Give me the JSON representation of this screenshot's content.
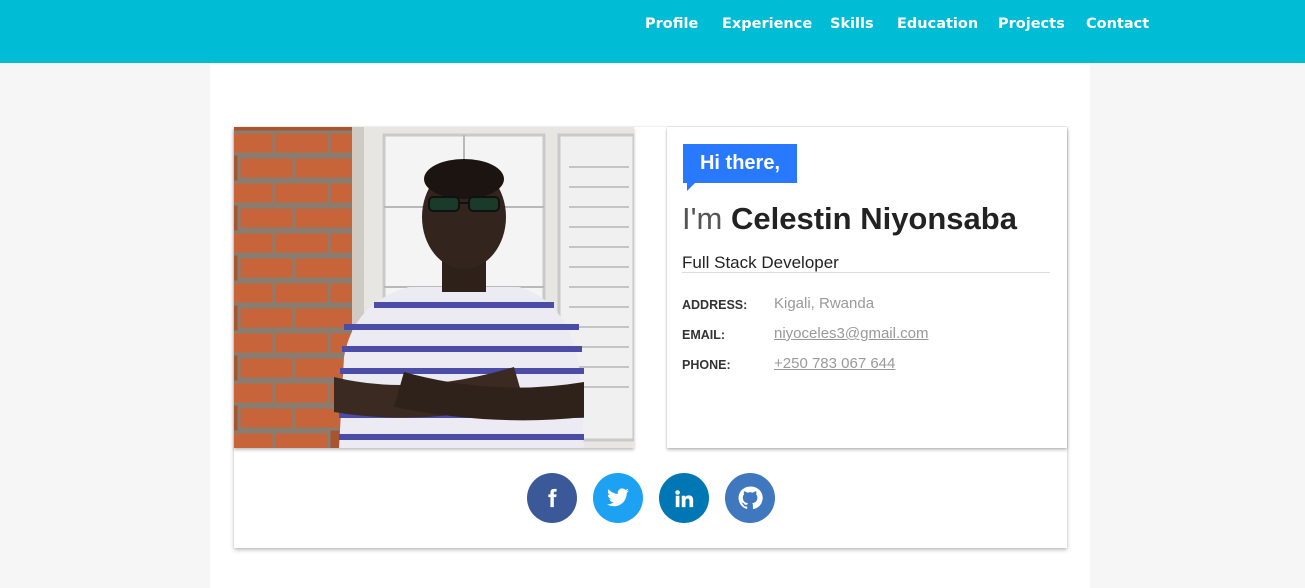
{
  "nav": {
    "items": [
      "Profile",
      "Experience",
      "Skills",
      "Education",
      "Projects",
      "Contact"
    ]
  },
  "profile": {
    "photo_alt": "profile-photo",
    "greeting": "Hi there,",
    "im": "I'm",
    "name": "Celestin Niyonsaba",
    "role": "Full Stack Developer",
    "address_label": "ADDRESS:",
    "address": "Kigali, Rwanda",
    "email_label": "EMAIL:",
    "email": "niyoceles3@gmail.com",
    "phone_label": "PHONE:",
    "phone": "+250 783 067 644"
  },
  "social": [
    {
      "name": "facebook-icon",
      "color": "#3b5998"
    },
    {
      "name": "twitter-icon",
      "color": "#1da1f2"
    },
    {
      "name": "linkedin-icon",
      "color": "#0077b5"
    },
    {
      "name": "github-icon",
      "color": "#4078c0"
    }
  ],
  "colors": {
    "topbar": "#00bcd4",
    "accent": "#2979ff"
  }
}
